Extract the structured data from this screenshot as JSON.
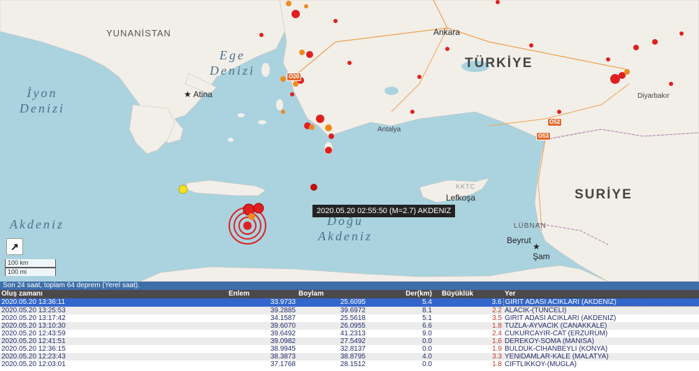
{
  "map": {
    "sea_labels": {
      "ege": "Ege\nDenizi",
      "iyon": "İyon\nDenizi",
      "akdeniz": "Akdeniz",
      "dogu_akdeniz": "Doğu\nAkdeniz"
    },
    "country_labels": {
      "yunanistan": "YUNANİSTAN",
      "turkiye": "TÜRKİYE",
      "suriye": "SURİYE",
      "lubnan": "LÜBNAN",
      "kktc": "KKTC"
    },
    "cities": {
      "ankara": "Ankara",
      "atina": "Atina",
      "antalya": "Antalya",
      "lefkosa": "Lefkoşa",
      "beyrut": "Beyrut",
      "sam": "Şam",
      "diyarbakir": "Diyarbakır"
    },
    "road_shields": [
      "O20",
      "O52",
      "O53"
    ],
    "tooltip": "2020.05.20 02:55:50 (M=2.7) AKDENIZ",
    "scale": {
      "km": "100 km",
      "mi": "100 mi"
    },
    "colors": {
      "sea": "#aad3df",
      "land": "#f2efe9",
      "quake_recent": "#e02020",
      "quake_old": "#f08a20",
      "quake_older": "#f5e020"
    }
  },
  "status": {
    "text": "Son 24 saat, toplam 64 deprem (Yerel saat)."
  },
  "table": {
    "headers": {
      "time": "Oluş zamanı",
      "lat": "Enlem",
      "lon": "Boylam",
      "depth": "Der(km)",
      "mag": "Büyüklük",
      "place": "Yer"
    },
    "rows": [
      {
        "time": "2020.05.20 13:36:11",
        "lat": "33.9733",
        "lon": "25.6095",
        "depth": "5.4",
        "mag": "3.6",
        "place": "GIRIT ADASI ACIKLARI (AKDENIZ)"
      },
      {
        "time": "2020.05.20 13:25:53",
        "lat": "39.2885",
        "lon": "39.6972",
        "depth": "8.1",
        "mag": "2.2",
        "place": "ALACIK-(TUNCELI)"
      },
      {
        "time": "2020.05.20 13:17:42",
        "lat": "34.1587",
        "lon": "25.5618",
        "depth": "5.1",
        "mag": "3.5",
        "place": "GIRIT ADASI ACIKLARI (AKDENIZ)"
      },
      {
        "time": "2020.05.20 13:10:30",
        "lat": "39.6070",
        "lon": "26.0955",
        "depth": "6.6",
        "mag": "1.8",
        "place": "TUZLA-AYVACIK (CANAKKALE)"
      },
      {
        "time": "2020.05.20 12:43:59",
        "lat": "39.6492",
        "lon": "41.2313",
        "depth": "9.0",
        "mag": "2.4",
        "place": "CUKURCAYIR-CAT (ERZURUM)"
      },
      {
        "time": "2020.05.20 12:41:51",
        "lat": "39.0982",
        "lon": "27.5492",
        "depth": "0.0",
        "mag": "1.6",
        "place": "DEREKOY-SOMA (MANISA)"
      },
      {
        "time": "2020.05.20 12:36:15",
        "lat": "38.9945",
        "lon": "32.8137",
        "depth": "0.0",
        "mag": "1.9",
        "place": "BULDUK-CIHANBEYLI (KONYA)"
      },
      {
        "time": "2020.05.20 12:23:43",
        "lat": "38.3873",
        "lon": "38.8795",
        "depth": "4.0",
        "mag": "3.3",
        "place": "YENIDAMLAR-KALE (MALATYA)"
      },
      {
        "time": "2020.05.20 12:03:01",
        "lat": "37.1768",
        "lon": "28.1512",
        "depth": "0.0",
        "mag": "1.8",
        "place": "CIFTLIKKOY-(MUGLA)"
      }
    ]
  }
}
